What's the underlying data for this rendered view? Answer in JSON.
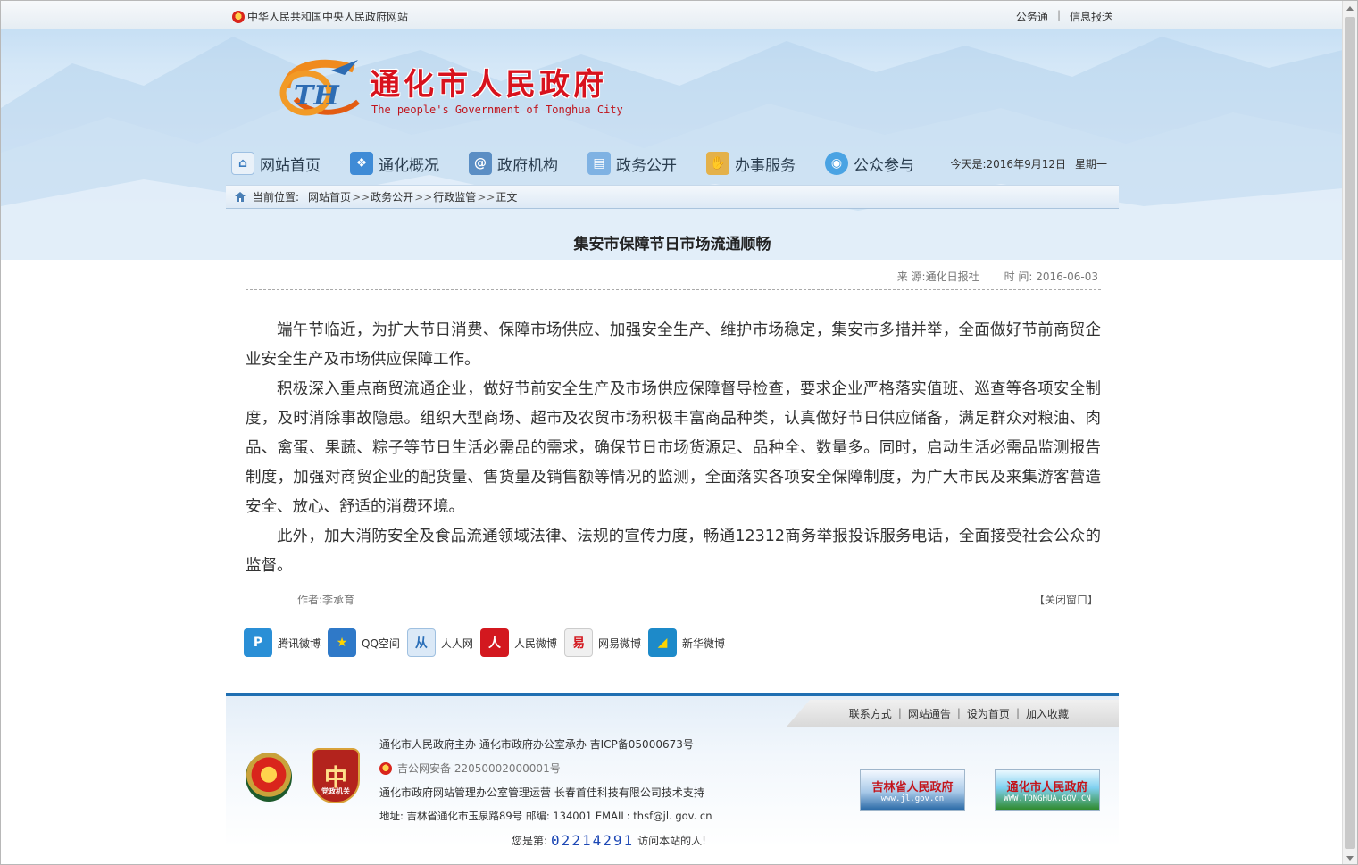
{
  "top": {
    "site_link": "中华人民共和国中央人民政府网站",
    "links": [
      "公务通",
      "信息报送"
    ]
  },
  "logo": {
    "title": "通化市人民政府",
    "subtitle": "The people's Government of Tonghua City"
  },
  "nav": {
    "items": [
      {
        "label": "网站首页",
        "icon": "home-icon"
      },
      {
        "label": "通化概况",
        "icon": "overview-icon"
      },
      {
        "label": "政府机构",
        "icon": "organization-icon"
      },
      {
        "label": "政务公开",
        "icon": "document-icon"
      },
      {
        "label": "办事服务",
        "icon": "service-icon"
      },
      {
        "label": "公众参与",
        "icon": "chat-icon"
      }
    ],
    "date_label": "今天是:2016年9月12日",
    "weekday": "星期一"
  },
  "breadcrumb": {
    "prefix": "当前位置:",
    "items": [
      "网站首页",
      "政务公开",
      "行政监管",
      "正文"
    ]
  },
  "article": {
    "title": "集安市保障节日市场流通顺畅",
    "source_label": "来 源:通化日报社",
    "time_label": "时 间: 2016-06-03",
    "paragraphs": [
      "端午节临近，为扩大节日消费、保障市场供应、加强安全生产、维护市场稳定，集安市多措并举，全面做好节前商贸企业安全生产及市场供应保障工作。",
      "积极深入重点商贸流通企业，做好节前安全生产及市场供应保障督导检查，要求企业严格落实值班、巡查等各项安全制度，及时消除事故隐患。组织大型商场、超市及农贸市场积极丰富商品种类，认真做好节日供应储备，满足群众对粮油、肉品、禽蛋、果蔬、粽子等节日生活必需品的需求，确保节日市场货源足、品种全、数量多。同时，启动生活必需品监测报告制度，加强对商贸企业的配货量、售货量及销售额等情况的监测，全面落实各项安全保障制度，为广大市民及来集游客营造安全、放心、舒适的消费环境。",
      "此外，加大消防安全及食品流通领域法律、法规的宣传力度，畅通12312商务举报投诉服务电话，全面接受社会公众的监督。"
    ],
    "author": "作者:李承育",
    "close_window": "【关闭窗口】"
  },
  "share": [
    {
      "label": "腾讯微博",
      "icon": "tencent-weibo-icon",
      "color": "#2a8fd6"
    },
    {
      "label": "QQ空间",
      "icon": "qzone-icon",
      "color": "#2f79c8"
    },
    {
      "label": "人人网",
      "icon": "renren-icon",
      "color": "#2b6fb8"
    },
    {
      "label": "人民微博",
      "icon": "people-weibo-icon",
      "color": "#d3181f"
    },
    {
      "label": "网易微博",
      "icon": "netease-weibo-icon",
      "color": "#e8e8e8"
    },
    {
      "label": "新华微博",
      "icon": "xinhua-weibo-icon",
      "color": "#1d8ac9"
    }
  ],
  "footer": {
    "links": [
      "联系方式",
      "网站通告",
      "设为首页",
      "加入收藏"
    ],
    "line1": "通化市人民政府主办  通化市政府办公室承办  吉ICP备05000673号",
    "line2": "吉公网安备  22050002000001号",
    "line3": "通化市政府网站管理办公室管理运营  长春首佳科技有限公司技术支持",
    "line4": "地址: 吉林省通化市玉泉路89号  邮编: 134001  EMAIL: thsf@jl. gov. cn",
    "visit_prefix": "您是第:",
    "visit_count": "02214291",
    "visit_suffix": "访问本站的人!",
    "badge_label": "党政机关",
    "banner_jl": {
      "title": "吉林省人民政府",
      "url": "www.jl.gov.cn"
    },
    "banner_th": {
      "title": "通化市人民政府",
      "url": "WWW.TONGHUA.GOV.CN"
    }
  }
}
